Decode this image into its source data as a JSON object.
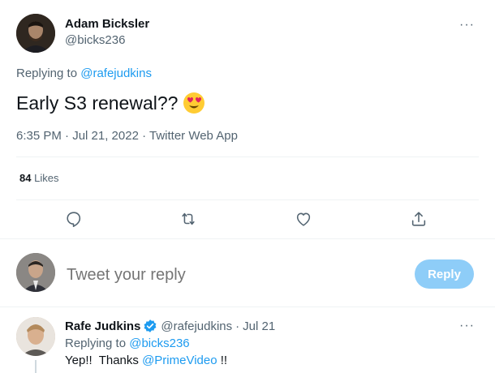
{
  "main_tweet": {
    "author_name": "Adam Bicksler",
    "author_handle": "@bicks236",
    "replying_prefix": "Replying to ",
    "replying_to": "@rafejudkins",
    "text": "Early S3 renewal??",
    "emoji": "😍",
    "timestamp": "6:35 PM · Jul 21, 2022 · Twitter Web App",
    "likes_count": "84",
    "likes_label": "Likes",
    "more_label": "···"
  },
  "actions": {
    "reply_icon": "reply-icon",
    "retweet_icon": "retweet-icon",
    "like_icon": "heart-icon",
    "share_icon": "share-icon"
  },
  "composer": {
    "placeholder": "Tweet your reply",
    "button_label": "Reply"
  },
  "reply_tweet": {
    "author_name": "Rafe Judkins",
    "verified": true,
    "author_handle": "@rafejudkins",
    "separator": "·",
    "date": "Jul 21",
    "replying_prefix": "Replying to ",
    "replying_to": "@bicks236",
    "text_start": "Yep!!  Thanks ",
    "mention": "@PrimeVideo",
    "text_end": " !!",
    "more_label": "···"
  },
  "colors": {
    "accent": "#1d9bf0",
    "reply_button_disabled": "#8ecdf8",
    "secondary_text": "#536471"
  }
}
